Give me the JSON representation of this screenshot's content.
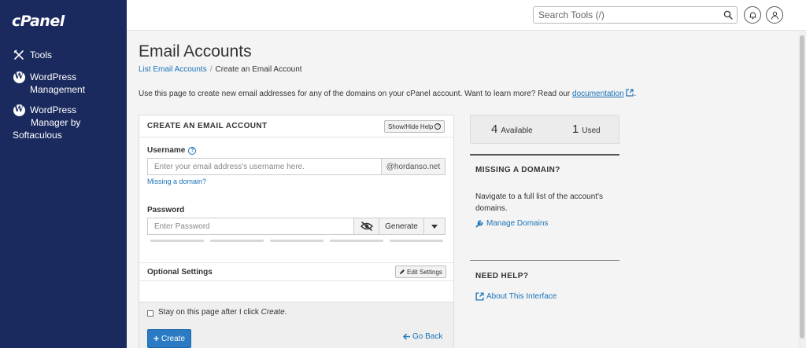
{
  "brand": {
    "logo": "cPanel"
  },
  "sidebar": {
    "items": [
      {
        "label": "Tools",
        "icon": "tools-icon"
      },
      {
        "label_line1": "WordPress",
        "label_line2": "Management",
        "icon": "wordpress-icon"
      },
      {
        "label_line1": "WordPress",
        "label_line2": "Manager by",
        "label_line3": "Softaculous",
        "icon": "wordpress-icon"
      }
    ]
  },
  "header": {
    "search_placeholder": "Search Tools (/)",
    "icons": [
      "search-icon",
      "bell-icon",
      "user-icon"
    ]
  },
  "page": {
    "title": "Email Accounts",
    "breadcrumb": {
      "link": "List Email Accounts",
      "separator": "/",
      "current": "Create an Email Account"
    },
    "intro_prefix": "Use this page to create new email addresses for any of the domains on your cPanel account. Want to learn more? Read our",
    "intro_link": "documentation",
    "intro_suffix": "."
  },
  "form": {
    "title": "CREATE AN EMAIL ACCOUNT",
    "show_hide_help": "Show/Hide Help",
    "username_label": "Username",
    "username_placeholder": "Enter your email address's username here.",
    "domain": "@hordanso.net",
    "missing_domain_link": "Missing a domain?",
    "password_label": "Password",
    "password_placeholder": "Enter Password",
    "generate_label": "Generate",
    "password_strength_segments": 5,
    "optional_settings_title": "Optional Settings",
    "edit_settings": "Edit Settings",
    "stay_label_prefix": "Stay on this page after I click ",
    "stay_label_em": "Create",
    "stay_label_suffix": ".",
    "stay_checked": false,
    "create_label": "Create",
    "go_back_label": "Go Back"
  },
  "stats": {
    "available_count": "4",
    "available_label": "Available",
    "used_count": "1",
    "used_label": "Used"
  },
  "missing_domain_panel": {
    "title": "MISSING A DOMAIN?",
    "text": "Navigate to a full list of the account's domains.",
    "link": "Manage Domains"
  },
  "need_help_panel": {
    "title": "NEED HELP?",
    "link": "About This Interface"
  },
  "colors": {
    "sidebar_bg": "#1b2a5e",
    "link": "#1a73b8",
    "primary_button": "#2a7bc4"
  }
}
